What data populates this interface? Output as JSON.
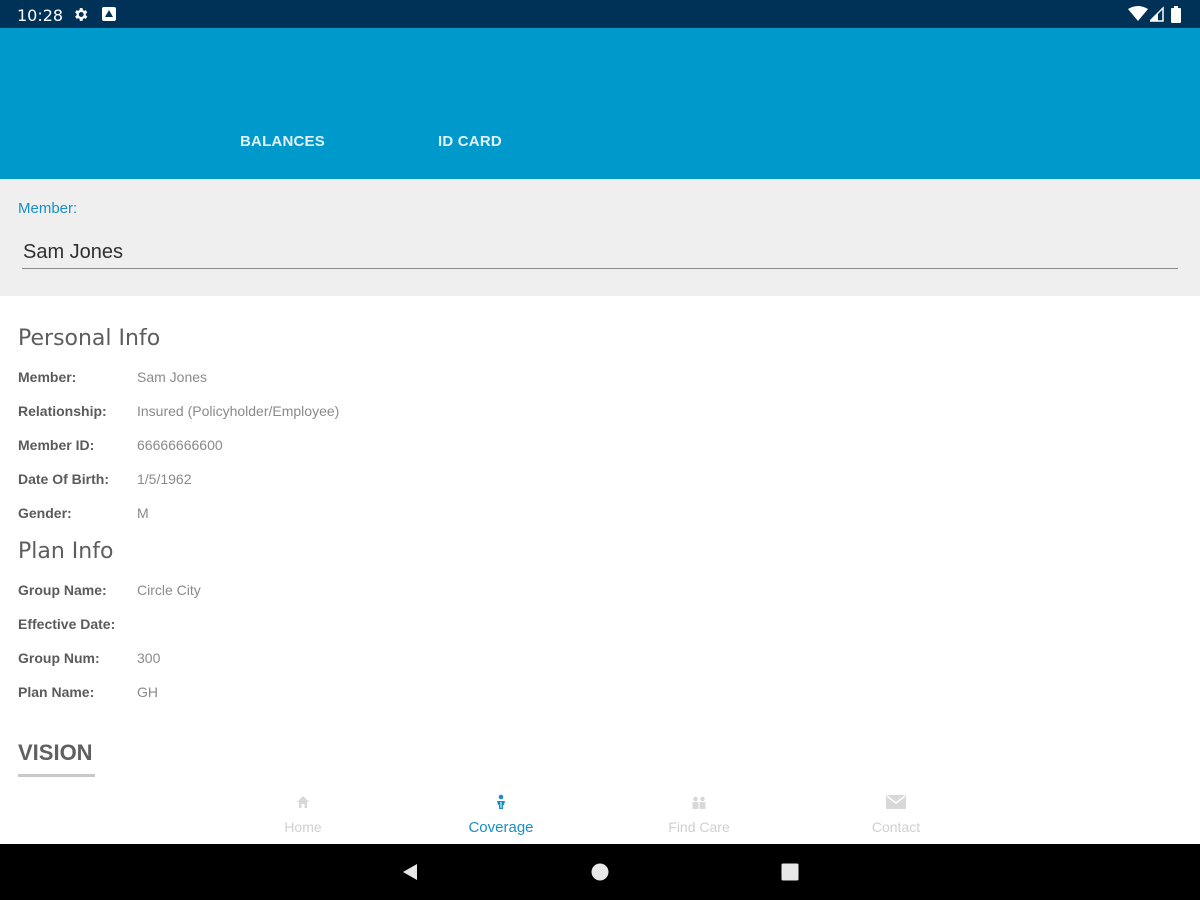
{
  "status_bar": {
    "time": "10:28",
    "icons": [
      "settings-icon",
      "notification-icon",
      "wifi-icon",
      "signal-icon",
      "battery-icon"
    ]
  },
  "tabs": [
    {
      "label": "BALANCES"
    },
    {
      "label": "ID CARD"
    }
  ],
  "member_selector": {
    "label": "Member:",
    "value": "Sam Jones"
  },
  "personal_info": {
    "title": "Personal Info",
    "rows": [
      {
        "label": "Member:",
        "value": "Sam Jones"
      },
      {
        "label": "Relationship:",
        "value": "Insured (Policyholder/Employee)"
      },
      {
        "label": "Member ID:",
        "value": "66666666600"
      },
      {
        "label": "Date Of Birth:",
        "value": "1/5/1962"
      },
      {
        "label": "Gender:",
        "value": "M"
      }
    ]
  },
  "plan_info": {
    "title": "Plan Info",
    "rows": [
      {
        "label": "Group Name:",
        "value": "Circle City"
      },
      {
        "label": "Effective Date:",
        "value": ""
      },
      {
        "label": "Group Num:",
        "value": "300"
      },
      {
        "label": "Plan Name:",
        "value": "GH"
      }
    ]
  },
  "coverage_section": {
    "title": "VISION"
  },
  "bottom_nav": {
    "items": [
      {
        "label": "Home",
        "icon": "home-icon"
      },
      {
        "label": "Coverage",
        "icon": "person-icon",
        "active": true
      },
      {
        "label": "Find Care",
        "icon": "people-icon"
      },
      {
        "label": "Contact",
        "icon": "mail-icon"
      }
    ]
  },
  "colors": {
    "status_bar": "#003157",
    "app_bar": "#0099cc",
    "accent": "#1a8fc6",
    "panel_bg": "#efefef"
  }
}
